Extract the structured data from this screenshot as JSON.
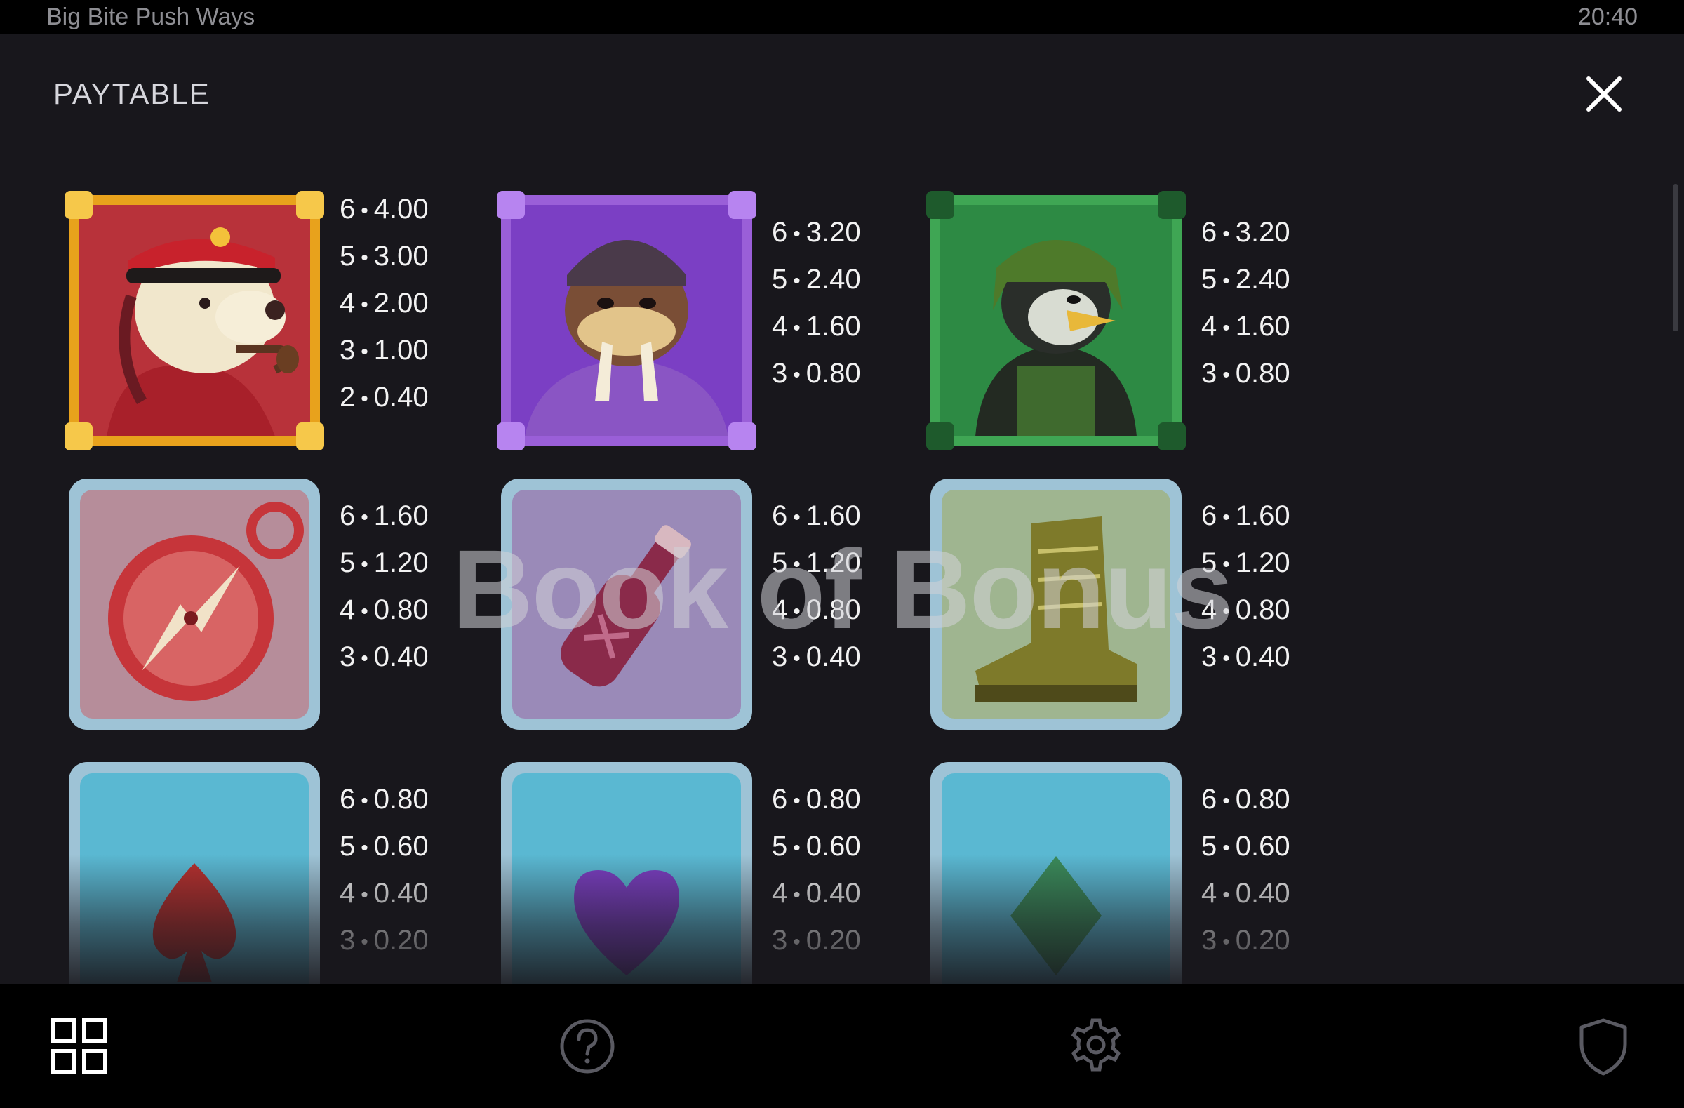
{
  "status_bar": {
    "app_title": "Big Bite Push Ways",
    "time": "20:40"
  },
  "header": {
    "title": "PAYTABLE",
    "close_icon": "close-icon"
  },
  "watermark": "Book of Bonus",
  "colors": {
    "panel_bg": "#18171c",
    "bar_bg": "#000000",
    "text": "#f2f2f2",
    "gold_frame": "#e8a21c",
    "purple_frame": "#9a5fd8",
    "green_frame": "#3fa654",
    "ice_frame": "#9ec3d6"
  },
  "symbols": [
    {
      "name": "polar-bear-captain",
      "icon": "polar-bear-captain-symbol",
      "frame": "gold",
      "pays": [
        {
          "count": "6",
          "value": "4.00"
        },
        {
          "count": "5",
          "value": "3.00"
        },
        {
          "count": "4",
          "value": "2.00"
        },
        {
          "count": "3",
          "value": "1.00"
        },
        {
          "count": "2",
          "value": "0.40"
        }
      ]
    },
    {
      "name": "walrus",
      "icon": "walrus-symbol",
      "frame": "purple",
      "pays": [
        {
          "count": "6",
          "value": "3.20"
        },
        {
          "count": "5",
          "value": "2.40"
        },
        {
          "count": "4",
          "value": "1.60"
        },
        {
          "count": "3",
          "value": "0.80"
        }
      ]
    },
    {
      "name": "penguin",
      "icon": "penguin-symbol",
      "frame": "green",
      "pays": [
        {
          "count": "6",
          "value": "3.20"
        },
        {
          "count": "5",
          "value": "2.40"
        },
        {
          "count": "4",
          "value": "1.60"
        },
        {
          "count": "3",
          "value": "0.80"
        }
      ]
    },
    {
      "name": "compass",
      "icon": "compass-symbol",
      "frame": "ice",
      "pays": [
        {
          "count": "6",
          "value": "1.60"
        },
        {
          "count": "5",
          "value": "1.20"
        },
        {
          "count": "4",
          "value": "0.80"
        },
        {
          "count": "3",
          "value": "0.40"
        }
      ]
    },
    {
      "name": "bottle",
      "icon": "bottle-symbol",
      "frame": "ice",
      "pays": [
        {
          "count": "6",
          "value": "1.60"
        },
        {
          "count": "5",
          "value": "1.20"
        },
        {
          "count": "4",
          "value": "0.80"
        },
        {
          "count": "3",
          "value": "0.40"
        }
      ]
    },
    {
      "name": "boot",
      "icon": "boot-symbol",
      "frame": "ice",
      "pays": [
        {
          "count": "6",
          "value": "1.60"
        },
        {
          "count": "5",
          "value": "1.20"
        },
        {
          "count": "4",
          "value": "0.80"
        },
        {
          "count": "3",
          "value": "0.40"
        }
      ]
    },
    {
      "name": "spade",
      "icon": "spade-symbol",
      "frame": "ice",
      "pays": [
        {
          "count": "6",
          "value": "0.80"
        },
        {
          "count": "5",
          "value": "0.60"
        },
        {
          "count": "4",
          "value": "0.40"
        },
        {
          "count": "3",
          "value": "0.20"
        }
      ]
    },
    {
      "name": "heart",
      "icon": "heart-symbol",
      "frame": "ice",
      "pays": [
        {
          "count": "6",
          "value": "0.80"
        },
        {
          "count": "5",
          "value": "0.60"
        },
        {
          "count": "4",
          "value": "0.40"
        },
        {
          "count": "3",
          "value": "0.20"
        }
      ]
    },
    {
      "name": "diamond",
      "icon": "diamond-symbol",
      "frame": "ice",
      "pays": [
        {
          "count": "6",
          "value": "0.80"
        },
        {
          "count": "5",
          "value": "0.60"
        },
        {
          "count": "4",
          "value": "0.40"
        },
        {
          "count": "3",
          "value": "0.20"
        }
      ]
    }
  ],
  "bottom_nav": [
    {
      "id": "grid",
      "icon": "grid-menu-icon"
    },
    {
      "id": "help",
      "icon": "help-icon"
    },
    {
      "id": "settings",
      "icon": "gear-icon"
    },
    {
      "id": "responsible",
      "icon": "shield-icon"
    }
  ]
}
